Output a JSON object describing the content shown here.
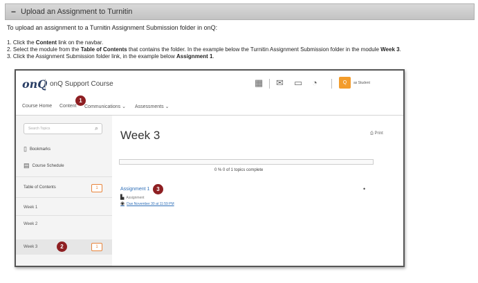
{
  "section": {
    "collapse_symbol": "−",
    "title": "Upload an Assignment to Turnitin"
  },
  "intro": "To upload an assignment to a Turnitin Assignment Submission folder in onQ:",
  "steps": [
    {
      "pre": "1. Click the ",
      "bold": "Content",
      "mid": " link on the navbar.",
      "bold2": "",
      "post": ""
    },
    {
      "pre": "2. Select the module from the ",
      "bold": "Table of Contents",
      "mid": " that contains the folder.  In the example below the Turnitin Assignment Submission folder in the module ",
      "bold2": "Week 3",
      "post": "."
    },
    {
      "pre": "3. Click the Assignment Submission folder link, in the example below ",
      "bold": "Assignment 1",
      "mid": ".",
      "bold2": "",
      "post": ""
    }
  ],
  "screenshot": {
    "logo": "onQ",
    "course": "onQ Support Course",
    "icons": [
      "grid-icon",
      "mail-icon",
      "chat-icon",
      "bell-icon"
    ],
    "role": "as Student",
    "nav": [
      "Course Home",
      "Content",
      "Communications ⌄",
      "Assessments ⌄"
    ],
    "search_placeholder": "Search Topics",
    "sidebar": {
      "bookmarks": "Bookmarks",
      "schedule": "Course Schedule",
      "toc": "Table of Contents",
      "toc_count": "1",
      "weeks": [
        "Week 1",
        "Week 2",
        "Week 3"
      ],
      "week3_count": "1"
    },
    "main": {
      "title": "Week 3",
      "print": "Print",
      "progress_fraction": 0,
      "progress_text": "0 %  0 of 1 topics complete",
      "assignment_title": "Assignment 1",
      "assignment_type": "Assignment",
      "assignment_due": "Due November 30 at 11:59 PM"
    },
    "badges": [
      "1",
      "2",
      "3"
    ]
  },
  "colors": {
    "badge": "#8e1f22",
    "accent_orange": "#f39c2b",
    "link_blue": "#2f6fb8"
  }
}
